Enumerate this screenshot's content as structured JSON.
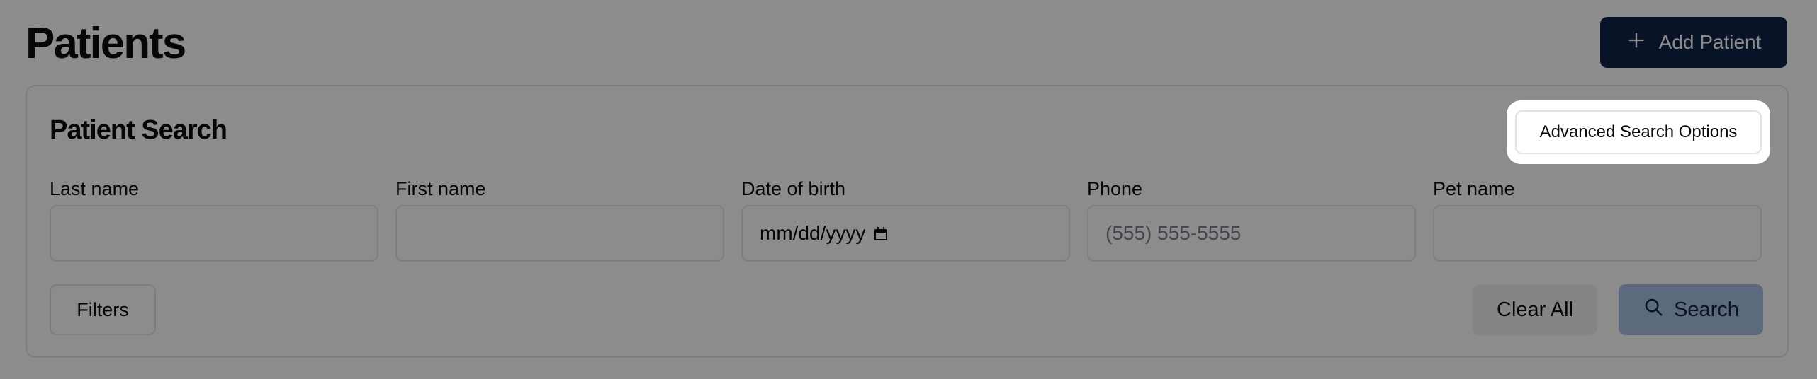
{
  "header": {
    "title": "Patients",
    "add_label": "Add Patient"
  },
  "search_card": {
    "title": "Patient Search",
    "advanced_label": "Advanced Search Options",
    "fields": [
      {
        "label": "Last name",
        "value": "",
        "placeholder": ""
      },
      {
        "label": "First name",
        "value": "",
        "placeholder": ""
      },
      {
        "label": "Date of birth",
        "value": "mm/dd/yyyy",
        "placeholder": ""
      },
      {
        "label": "Phone",
        "value": "",
        "placeholder": "(555) 555-5555"
      },
      {
        "label": "Pet name",
        "value": "",
        "placeholder": ""
      }
    ],
    "filters_label": "Filters",
    "clear_label": "Clear All",
    "search_label": "Search"
  },
  "icons": {
    "add": "plus-icon",
    "search": "search-icon",
    "date": "calendar-icon"
  },
  "colors": {
    "primary": "#0f2447",
    "search_button": "#a9c1e4",
    "overlay": "rgba(0,0,0,0.45)"
  }
}
